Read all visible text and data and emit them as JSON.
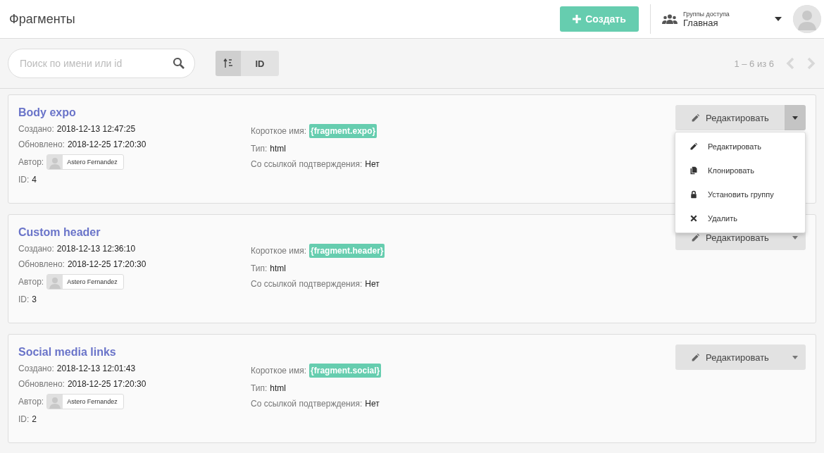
{
  "header": {
    "title": "Фрагменты",
    "create_button": "Создать",
    "access": {
      "label": "Группы доступа",
      "value": "Главная"
    }
  },
  "toolbar": {
    "search": {
      "placeholder": "Поиск по имени или id"
    },
    "sort": [
      {
        "kind": "icon",
        "selected": true
      },
      {
        "kind": "text",
        "label": "ID",
        "selected": false
      }
    ],
    "pagination": "1 – 6 из 6"
  },
  "menu_items": [
    {
      "kind": "edit",
      "label": "Редактировать"
    },
    {
      "kind": "clone",
      "label": "Клонировать"
    },
    {
      "kind": "lock",
      "label": "Установить группу"
    },
    {
      "kind": "delete",
      "label": "Удалить"
    }
  ],
  "fragments": [
    {
      "name": "Body expo",
      "created_label": "Создано:",
      "created": "2018-12-13 12:47:25",
      "updated_label": "Обновлено:",
      "updated": "2018-12-25 17:20:30",
      "author_label": "Автор:",
      "author": "Astero Fernandez",
      "id_label": "ID:",
      "id": "4",
      "short_label": "Короткое имя:",
      "short": "{fragment.expo}",
      "type_label": "Тип:",
      "type": "html",
      "confirm_label": "Со ссылкой подтверждения:",
      "confirm": "Нет",
      "edit_button": "Редактировать",
      "menu_open": true
    },
    {
      "name": "Custom header",
      "created_label": "Создано:",
      "created": "2018-12-13 12:36:10",
      "updated_label": "Обновлено:",
      "updated": "2018-12-25 17:20:30",
      "author_label": "Автор:",
      "author": "Astero Fernandez",
      "id_label": "ID:",
      "id": "3",
      "short_label": "Короткое имя:",
      "short": "{fragment.header}",
      "type_label": "Тип:",
      "type": "html",
      "confirm_label": "Со ссылкой подтверждения:",
      "confirm": "Нет",
      "edit_button": "Редактировать",
      "menu_open": false
    },
    {
      "name": "Social media links",
      "created_label": "Создано:",
      "created": "2018-12-13 12:01:43",
      "updated_label": "Обновлено:",
      "updated": "2018-12-25 17:20:30",
      "author_label": "Автор:",
      "author": "Astero Fernandez",
      "id_label": "ID:",
      "id": "2",
      "short_label": "Короткое имя:",
      "short": "{fragment.social}",
      "type_label": "Тип:",
      "type": "html",
      "confirm_label": "Со ссылкой подтверждения:",
      "confirm": "Нет",
      "edit_button": "Редактировать",
      "menu_open": false
    }
  ]
}
